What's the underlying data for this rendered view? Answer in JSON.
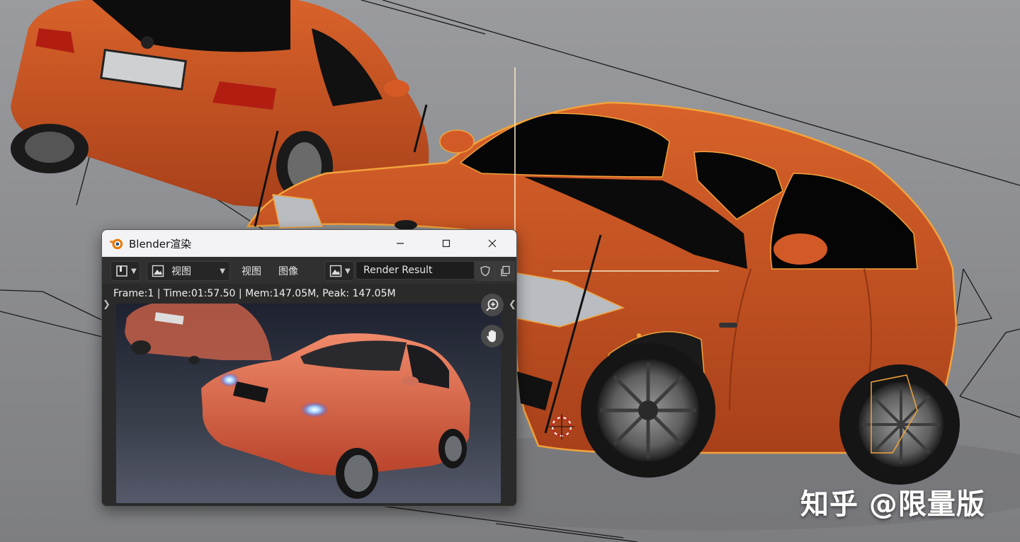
{
  "window": {
    "title": "Blender渲染",
    "minimize_icon": "minimize-icon",
    "maximize_icon": "maximize-icon",
    "close_icon": "close-icon"
  },
  "toolbar": {
    "view_dropdown_label": "视图",
    "menu_view": "视图",
    "menu_image": "图像",
    "image_name": "Render Result"
  },
  "render": {
    "frame_info": "Frame:1 | Time:01:57.50 | Mem:147.05M, Peak: 147.05M"
  },
  "watermark": "知乎 @限量版",
  "colors": {
    "car_orange": "#c8501a",
    "selection_outline": "#f3a33c",
    "viewport_gray": "#8f9093",
    "blender_orange": "#e87d0d"
  }
}
